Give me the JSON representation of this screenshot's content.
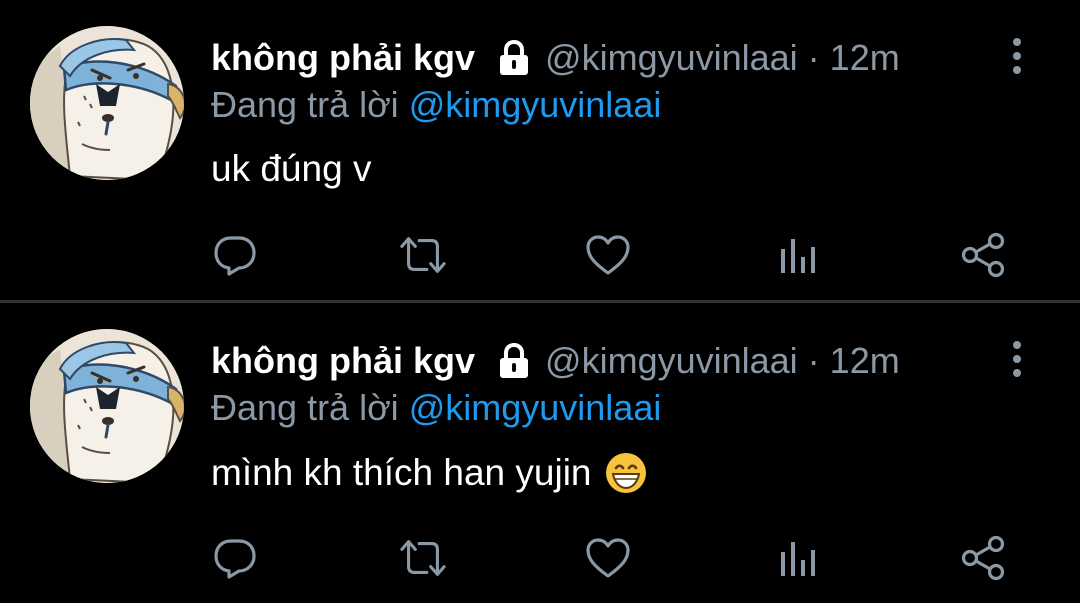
{
  "colors": {
    "background": "#000000",
    "text": "#ffffff",
    "secondary": "#8b98a5",
    "link": "#1d9bf0",
    "divider": "#2f3336"
  },
  "tweets": [
    {
      "display_name": "không phải kgv",
      "handle": "@kimgyuvinlaai",
      "separator": "·",
      "time": "12m",
      "reply_prefix": "Đang trả lời",
      "reply_to": "@kimgyuvinlaai",
      "text": "uk đúng v",
      "emoji": null,
      "icons": [
        "lock-icon",
        "more-icon",
        "reply-icon",
        "retweet-icon",
        "like-icon",
        "views-icon",
        "share-icon"
      ]
    },
    {
      "display_name": "không phải kgv",
      "handle": "@kimgyuvinlaai",
      "separator": "·",
      "time": "12m",
      "reply_prefix": "Đang trả lời",
      "reply_to": "@kimgyuvinlaai",
      "text": "mình kh thích han yujin",
      "emoji": "grinning-face-emoji",
      "icons": [
        "lock-icon",
        "more-icon",
        "reply-icon",
        "retweet-icon",
        "like-icon",
        "views-icon",
        "share-icon"
      ]
    }
  ]
}
